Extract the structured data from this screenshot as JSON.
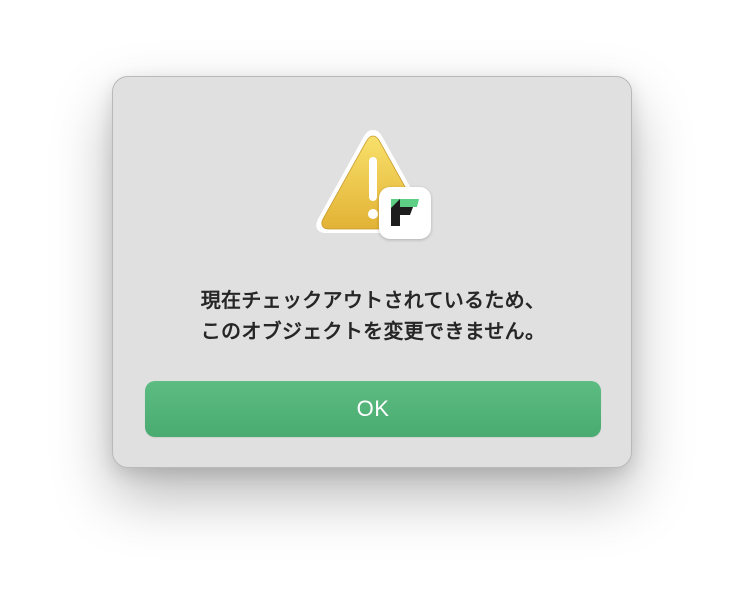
{
  "dialog": {
    "icons": {
      "warning": "warning-triangle-icon",
      "app": "app-logo-icon"
    },
    "message_lines": [
      "現在チェックアウトされているため、",
      "このオブジェクトを変更できません。"
    ],
    "ok_label": "OK"
  },
  "colors": {
    "dialog_background": "#e0e0e0",
    "ok_button": "#52b377",
    "warning_yellow": "#f2cc3e",
    "app_logo_green": "#5ccf84",
    "app_logo_dark": "#1d1d1d"
  }
}
